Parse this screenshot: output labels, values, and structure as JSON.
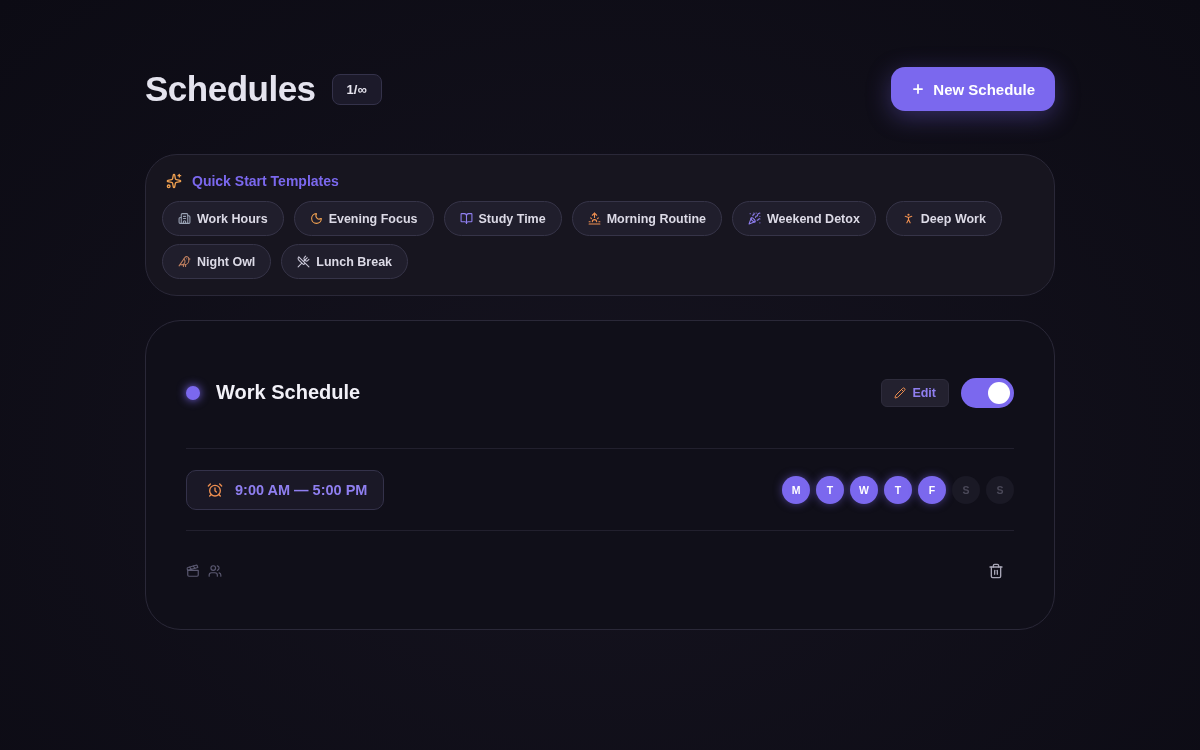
{
  "header": {
    "title": "Schedules",
    "count": "1/∞",
    "new_button": "New Schedule"
  },
  "templates": {
    "title": "Quick Start Templates",
    "items": [
      {
        "label": "Work Hours",
        "kind": "building"
      },
      {
        "label": "Evening Focus",
        "kind": "moon"
      },
      {
        "label": "Study Time",
        "kind": "books"
      },
      {
        "label": "Morning Routine",
        "kind": "sunrise"
      },
      {
        "label": "Weekend Detox",
        "kind": "party"
      },
      {
        "label": "Deep Work",
        "kind": "meditate"
      },
      {
        "label": "Night Owl",
        "kind": "owl"
      },
      {
        "label": "Lunch Break",
        "kind": "plate"
      }
    ]
  },
  "schedules": [
    {
      "name": "Work Schedule",
      "color": "#7b68ee",
      "edit": "Edit",
      "on": true,
      "time": "9:00 AM — 5:00 PM",
      "days": [
        {
          "label": "M",
          "selected": true
        },
        {
          "label": "T",
          "selected": true
        },
        {
          "label": "W",
          "selected": true
        },
        {
          "label": "T",
          "selected": true
        },
        {
          "label": "F",
          "selected": true
        },
        {
          "label": "S",
          "selected": false
        },
        {
          "label": "S",
          "selected": false
        }
      ]
    }
  ]
}
